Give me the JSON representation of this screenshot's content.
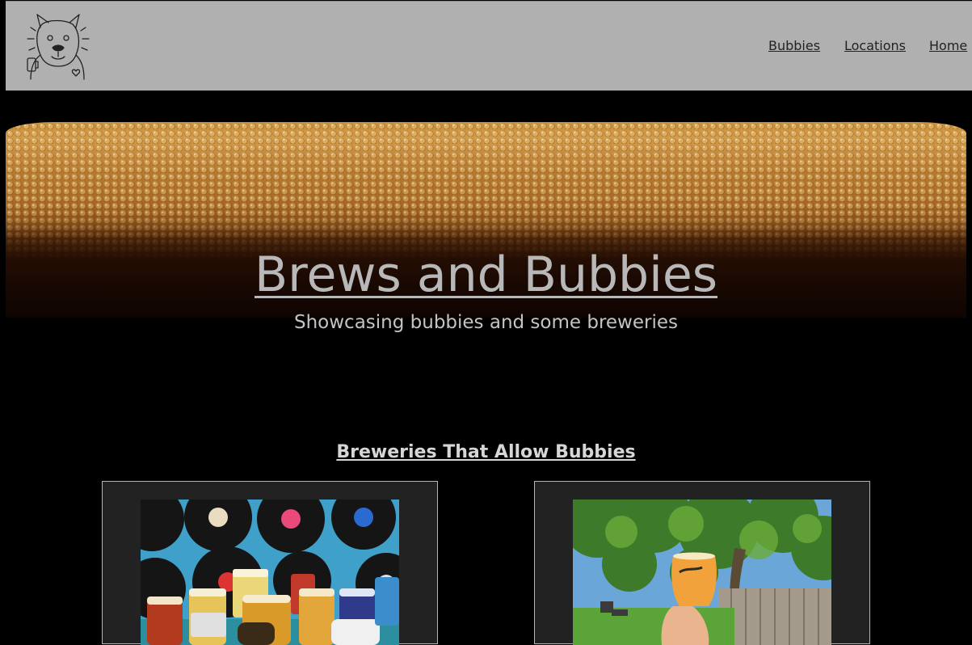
{
  "header": {
    "logo_alt": "bulldog-logo",
    "nav": [
      {
        "label": "Bubbies"
      },
      {
        "label": "Locations"
      },
      {
        "label": "Home"
      }
    ]
  },
  "hero": {
    "title": "Brews and Bubbies",
    "subtitle": "Showcasing bubbies and some breweries"
  },
  "section": {
    "heading": "Breweries That Allow Bubbies",
    "cards": [
      {
        "image": "records-and-beer-flight-photo"
      },
      {
        "image": "beer-glass-in-garden-photo"
      }
    ]
  },
  "colors": {
    "header_bg": "#b0b0b0",
    "page_bg": "#000000",
    "card_bg": "#222222",
    "hero_text": "#b8b8b8"
  }
}
